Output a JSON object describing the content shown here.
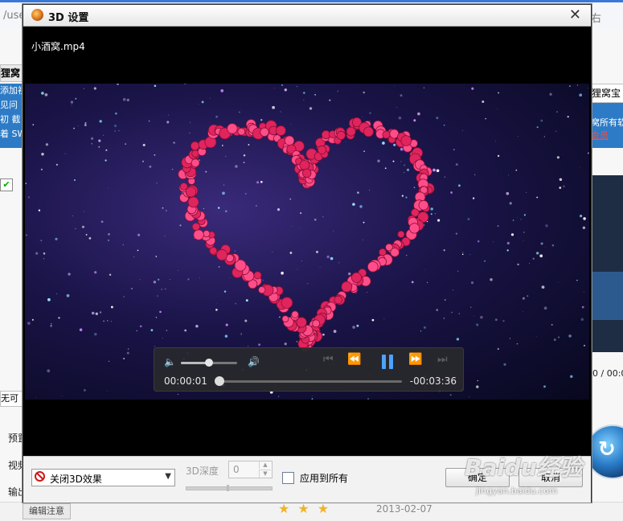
{
  "background_app": {
    "url_fragment": "/use",
    "right_fragment": "右",
    "left_tab": "狸窝",
    "left_blue_lines": [
      "添加视",
      "见问",
      "初 截",
      "着 SWI"
    ],
    "left_checkbox": "✔",
    "left_dropdown": "无可",
    "left_labels": [
      "预置",
      "视频",
      "输出"
    ],
    "right_tab": "狸窝宝",
    "right_blue_text": "窝所有软",
    "right_blue_link": "会员",
    "right_time": "0 / 00:0",
    "edit_button": "编辑注意",
    "stars": "★★★",
    "date": "2013-02-07"
  },
  "dialog": {
    "title": "3D 设置",
    "close_icon": "✕",
    "filename": "小酒窝.mp4"
  },
  "player": {
    "vol_low_icon": "🔈",
    "vol_high_icon": "🔊",
    "volume_level": 0.5,
    "prev_icon": "⏮",
    "rewind_icon": "⏪",
    "forward_icon": "⏩",
    "next_icon": "⏭",
    "current_time": "00:00:01",
    "remaining_time": "-00:03:36",
    "progress": 0.005
  },
  "panel": {
    "effect_dropdown": "关闭3D效果",
    "dropdown_arrow": "▼",
    "depth_label": "3D深度",
    "depth_value": "0",
    "up_arrow": "▲",
    "down_arrow": "▼",
    "apply_all_label": "应用到所有",
    "ok_button": "确定",
    "cancel_button": "取消"
  },
  "watermark": {
    "brand": "Baidu经验",
    "url": "jingyan.baidu.com"
  },
  "colors": {
    "accent_blue": "#4aa3ff",
    "panel_bg": "#f2f2f2",
    "heart_red": "#e0245e",
    "close_3d_red": "#d01818"
  }
}
